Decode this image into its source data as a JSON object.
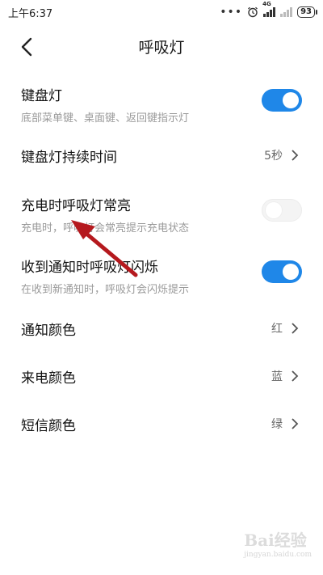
{
  "status_bar": {
    "time": "上午6:37",
    "dots": "•••",
    "network": "4G",
    "battery": "93"
  },
  "header": {
    "title": "呼吸灯"
  },
  "settings": [
    {
      "title": "键盘灯",
      "subtitle": "底部菜单键、桌面键、返回键指示灯",
      "toggle": true
    },
    {
      "title": "键盘灯持续时间",
      "value": "5秒"
    },
    {
      "title": "充电时呼吸灯常亮",
      "subtitle": "充电时，呼吸灯会常亮提示充电状态",
      "toggle": false
    },
    {
      "title": "收到通知时呼吸灯闪烁",
      "subtitle": "在收到新通知时，呼吸灯会闪烁提示",
      "toggle": true
    },
    {
      "title": "通知颜色",
      "value": "红"
    },
    {
      "title": "来电颜色",
      "value": "蓝"
    },
    {
      "title": "短信颜色",
      "value": "绿"
    }
  ],
  "watermark": {
    "brand": "Bai",
    "brand2": "经验",
    "site": "jingyan.baidu.com"
  },
  "colors": {
    "toggle_on": "#1f87e8",
    "annotation_arrow": "#b5191e"
  }
}
